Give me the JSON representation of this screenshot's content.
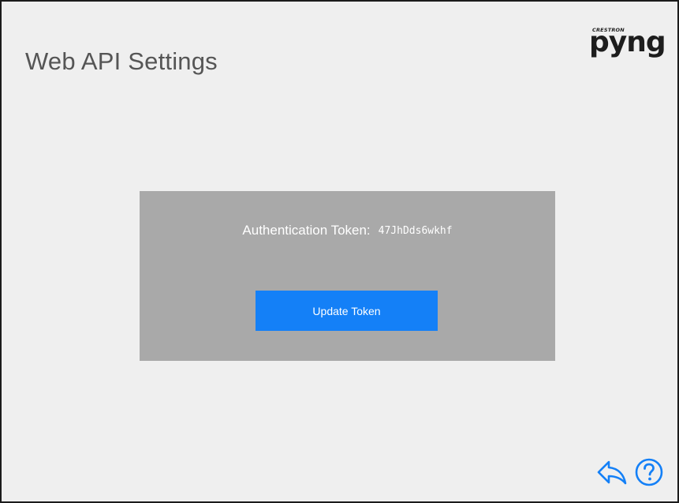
{
  "header": {
    "title": "Web API Settings"
  },
  "logo": {
    "brand": "CRESTRON",
    "product": "pyng"
  },
  "token": {
    "label": "Authentication Token:",
    "value": "47JhDds6wkhf"
  },
  "actions": {
    "update_label": "Update Token"
  },
  "footer": {
    "back_icon": "back-arrow-icon",
    "help_icon": "question-circle-icon"
  },
  "colors": {
    "accent": "#1480f7",
    "panel": "#a9a9a9",
    "background": "#efefef",
    "title_text": "#555555"
  }
}
